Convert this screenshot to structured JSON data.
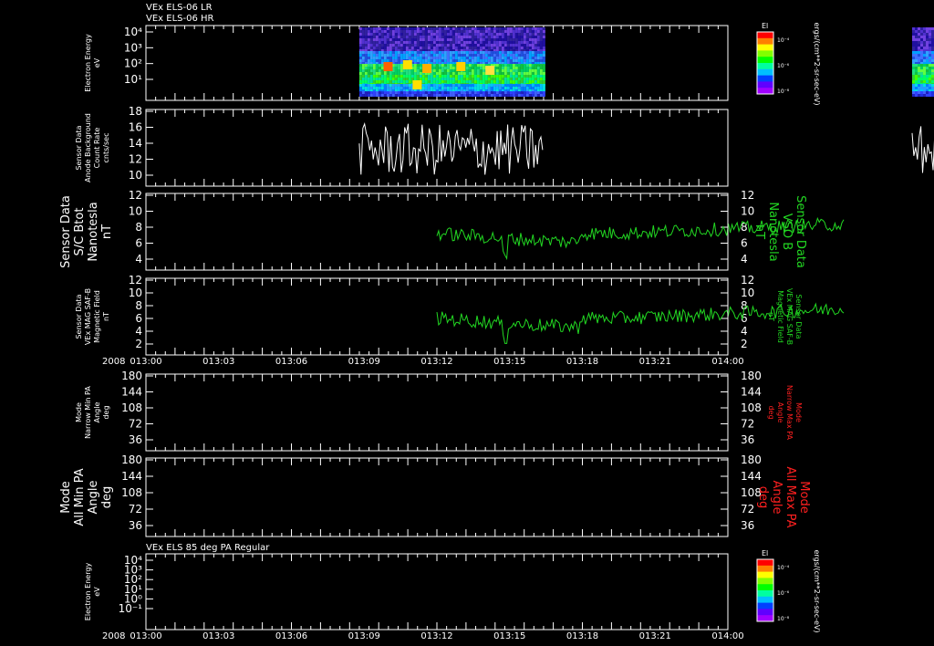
{
  "header": {
    "line1": "VEx ELS-06 LR",
    "line2": "VEx ELS-06 HR",
    "bottom_title": "VEx ELS 85 deg PA Regular"
  },
  "time_axis": {
    "year": "2008",
    "ticks": [
      "013:00",
      "013:03",
      "013:06",
      "013:09",
      "013:12",
      "013:15",
      "013:18",
      "013:21",
      "014:00"
    ]
  },
  "colorbar": {
    "title": "El",
    "unit": "ergs/(cm**2-sr-sec-eV)",
    "ticks": [
      "10⁻⁴",
      "10⁻⁶",
      "10⁻⁸"
    ]
  },
  "colors": {
    "white": "#ffffff",
    "green": "#22d822",
    "red": "#ff2020",
    "black": "#000000"
  },
  "chart_data": [
    {
      "type": "heatmap",
      "panel": "electron-energy",
      "ylabel": [
        "Electron Energy",
        "eV"
      ],
      "y_ticks": [
        "10⁴",
        "10³",
        "10²",
        "10¹"
      ],
      "ylim": [
        1,
        10000
      ],
      "y_scale": "log",
      "segments_minutes": [
        [
          22,
          41
        ],
        [
          79,
          97
        ]
      ]
    },
    {
      "type": "line",
      "panel": "anode-background",
      "ylabel": [
        "Sensor Data",
        "Anode Background",
        "Count Rate",
        "cnts/sec"
      ],
      "y_ticks": [
        "18",
        "16",
        "14",
        "12",
        "10"
      ],
      "ylim": [
        8.5,
        18
      ],
      "series": [
        {
          "color": "#ffffff",
          "segments_minutes": [
            [
              22,
              41
            ],
            [
              79,
              88
            ]
          ],
          "range": [
            9.5,
            17
          ]
        }
      ]
    },
    {
      "type": "line",
      "panel": "sc-btot",
      "ylabel": [
        "Sensor Data",
        "S/C Btot",
        "Nanotesla",
        "nT"
      ],
      "right_label": [
        "Sensor Data",
        "VSO B",
        "Nanotesla",
        "nT"
      ],
      "y_ticks": [
        "12",
        "10",
        "8",
        "6",
        "4"
      ],
      "ylim": [
        2,
        12
      ],
      "series": [
        {
          "color": "#22d822",
          "segments_minutes": [
            [
              30,
              72
            ],
            [
              99,
              120
            ]
          ],
          "range": [
            3.5,
            11.5
          ]
        }
      ]
    },
    {
      "type": "line",
      "panel": "mag-saf-b",
      "ylabel": [
        "Sensor Data",
        "VEx MAG SAF-B",
        "Magnetic Field",
        "nT"
      ],
      "right_label": [
        "Sensor Data",
        "VEx MAG SAF-B",
        "Magnetic Field",
        "nT"
      ],
      "y_ticks": [
        "12",
        "10",
        "8",
        "6",
        "4",
        "2"
      ],
      "ylim": [
        2,
        12
      ],
      "series": [
        {
          "color": "#22d822",
          "segments_minutes": [
            [
              30,
              72
            ],
            [
              99,
              120
            ]
          ],
          "range": [
            3.5,
            11.5
          ]
        }
      ]
    },
    {
      "type": "line",
      "panel": "narrow-pa",
      "ylabel": [
        "Mode",
        "Narrow Min PA",
        "Angle",
        "deg"
      ],
      "right_label": [
        "Mode",
        "Narrow Max PA",
        "Angle",
        "deg"
      ],
      "y_ticks": [
        "180",
        "144",
        "108",
        "72",
        "36"
      ],
      "ylim": [
        0,
        180
      ],
      "series": []
    },
    {
      "type": "line",
      "panel": "all-pa",
      "ylabel": [
        "Mode",
        "All Min PA",
        "Angle",
        "deg"
      ],
      "right_label": [
        "Mode",
        "All Max PA",
        "Angle",
        "deg"
      ],
      "y_ticks": [
        "180",
        "144",
        "108",
        "72",
        "36"
      ],
      "ylim": [
        0,
        180
      ],
      "series": []
    },
    {
      "type": "heatmap",
      "panel": "electron-energy-85",
      "ylabel": [
        "Electron Energy",
        "eV"
      ],
      "y_ticks": [
        "10⁴",
        "10³",
        "10²",
        "10¹",
        "10⁰",
        "10⁻¹"
      ],
      "ylim": [
        0.1,
        10000
      ],
      "y_scale": "log",
      "segments_minutes": []
    }
  ]
}
